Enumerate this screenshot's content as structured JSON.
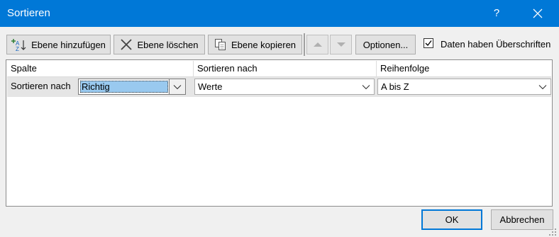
{
  "window": {
    "title": "Sortieren",
    "help_label": "?"
  },
  "toolbar": {
    "add_level": "Ebene hinzufügen",
    "delete_level": "Ebene löschen",
    "copy_level": "Ebene kopieren",
    "options": "Optionen...",
    "headers_checkbox": {
      "label": "Daten haben Überschriften",
      "checked": true
    }
  },
  "grid": {
    "headers": {
      "column": "Spalte",
      "sort_on": "Sortieren nach",
      "order": "Reihenfolge"
    },
    "rows": [
      {
        "label": "Sortieren nach",
        "column": "Richtig",
        "sort_on": "Werte",
        "order": "A bis Z"
      }
    ]
  },
  "footer": {
    "ok": "OK",
    "cancel": "Abbrechen"
  },
  "colors": {
    "titlebar": "#0078d7",
    "selection": "#99c9ef",
    "accent_border": "#0078d7"
  }
}
